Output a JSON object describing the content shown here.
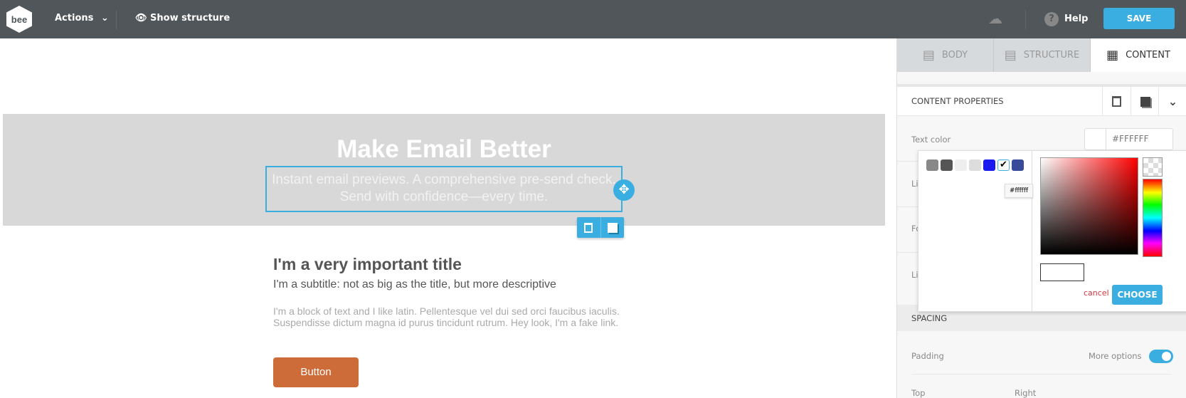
{
  "topbar": {
    "logo": "bee",
    "actions_label": "Actions",
    "show_structure_label": "Show structure",
    "help_label": "Help",
    "save_label": "SAVE"
  },
  "canvas": {
    "hero_title": "Make Email Better",
    "hero_subtitle": "Instant email previews. A comprehensive pre-send check. Send with confidence—every time.",
    "title": "I'm a very important title",
    "subtitle": "I'm a subtitle: not as big as the title, but more descriptive",
    "paragraph": "I'm a block of text and I like latin. Pellentesque vel dui sed orci faucibus iaculis. Suspendisse dictum magna id purus tincidunt rutrum. Hey look, I'm a fake link.",
    "button_label": "Button",
    "button_color": "#cd6c38"
  },
  "panel": {
    "tabs": [
      {
        "label": "BODY",
        "icon": "body-icon"
      },
      {
        "label": "STRUCTURE",
        "icon": "structure-icon"
      },
      {
        "label": "CONTENT",
        "icon": "grid-icon",
        "active": true
      }
    ],
    "content_properties_label": "CONTENT PROPERTIES",
    "text_color_label": "Text color",
    "text_color_value": "#FFFFFF",
    "hidden_rows": [
      "Li",
      "Fo",
      "Li"
    ],
    "spacing_label": "SPACING",
    "padding_label": "Padding",
    "more_options_label": "More options",
    "more_options_on": true,
    "top_label": "Top",
    "right_label": "Right"
  },
  "picker": {
    "swatches": [
      "#888888",
      "#555555",
      "#eeeeee",
      "#dddddd",
      "#1a1aee",
      "#ffffff",
      "#3a4a9a"
    ],
    "tooltip": "#ffffff",
    "cancel_label": "cancel",
    "choose_label": "CHOOSE"
  },
  "colors": {
    "accent": "#3aaee0",
    "topbar": "#505659"
  }
}
